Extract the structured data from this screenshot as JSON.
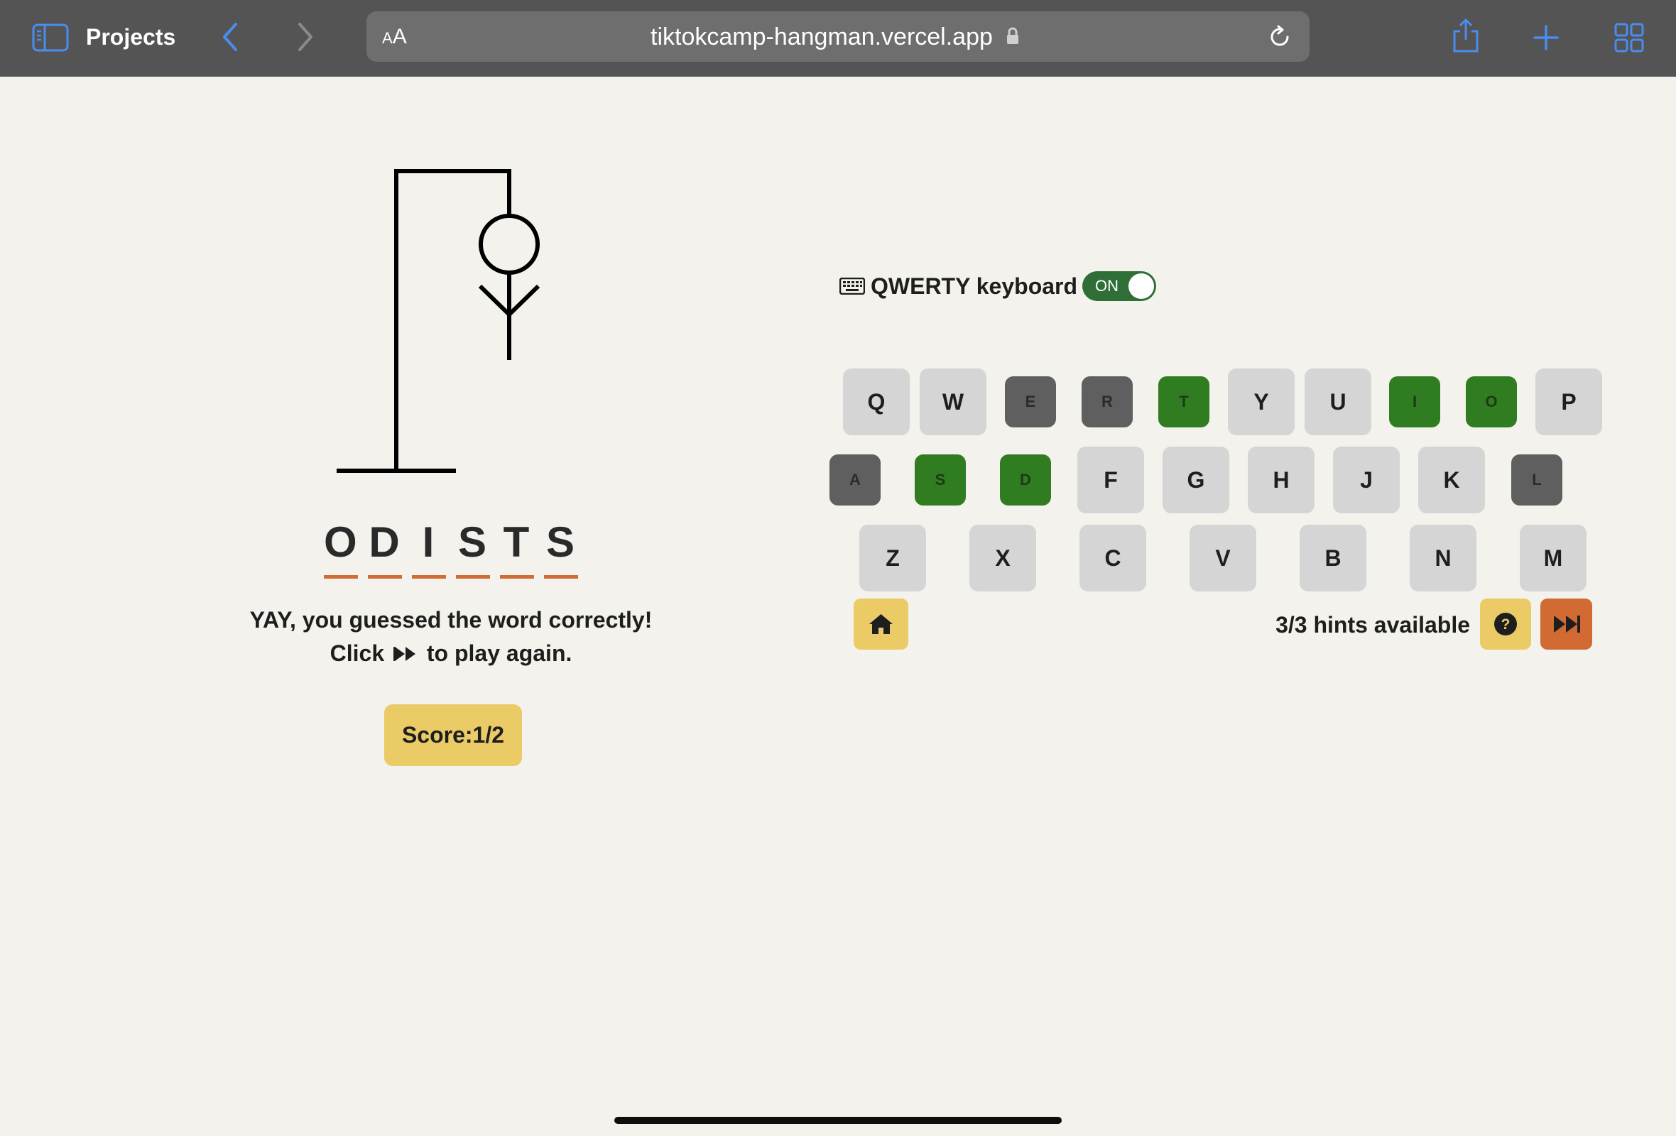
{
  "browser": {
    "sidebar_label": "Projects",
    "aa_label_small": "A",
    "aa_label_big": "A",
    "url": "tiktokcamp-hangman.vercel.app"
  },
  "game": {
    "word_letters": [
      "O",
      "D",
      "I",
      "S",
      "T",
      "S"
    ],
    "message_line1": "YAY, you guessed the word correctly!",
    "message_click": "Click",
    "message_rest": "to play again.",
    "score_label": "Score:1/2",
    "keyboard_label": "QWERTY keyboard",
    "toggle_label": "ON",
    "hints_label": "3/3 hints available"
  },
  "keyboard": {
    "rows": [
      [
        {
          "key": "Q",
          "state": "unused"
        },
        {
          "key": "W",
          "state": "unused"
        },
        {
          "key": "E",
          "state": "wrong"
        },
        {
          "key": "R",
          "state": "wrong"
        },
        {
          "key": "T",
          "state": "correct"
        },
        {
          "key": "Y",
          "state": "unused"
        },
        {
          "key": "U",
          "state": "unused"
        },
        {
          "key": "I",
          "state": "correct"
        },
        {
          "key": "O",
          "state": "correct"
        },
        {
          "key": "P",
          "state": "unused"
        }
      ],
      [
        {
          "key": "A",
          "state": "wrong"
        },
        {
          "key": "S",
          "state": "correct"
        },
        {
          "key": "D",
          "state": "correct"
        },
        {
          "key": "F",
          "state": "unused"
        },
        {
          "key": "G",
          "state": "unused"
        },
        {
          "key": "H",
          "state": "unused"
        },
        {
          "key": "J",
          "state": "unused"
        },
        {
          "key": "K",
          "state": "unused"
        },
        {
          "key": "L",
          "state": "wrong"
        }
      ],
      [
        {
          "key": "Z",
          "state": "unused"
        },
        {
          "key": "X",
          "state": "unused"
        },
        {
          "key": "C",
          "state": "unused"
        },
        {
          "key": "V",
          "state": "unused"
        },
        {
          "key": "B",
          "state": "unused"
        },
        {
          "key": "N",
          "state": "unused"
        },
        {
          "key": "M",
          "state": "unused"
        }
      ]
    ]
  },
  "colors": {
    "background": "#f3f2ec",
    "correct_key": "#307d21",
    "wrong_key": "#5f5f5f",
    "unused_key": "#d5d5d5",
    "accent_yellow": "#eacb66",
    "accent_orange": "#d16b33",
    "toggle_on": "#2f6f37"
  },
  "icons": {
    "sidebar": "sidebar-icon",
    "back": "chevron-left-icon",
    "forward": "chevron-right-icon",
    "lock": "lock-icon",
    "reload": "reload-icon",
    "share": "share-icon",
    "new_tab": "plus-icon",
    "tabs": "tabs-grid-icon",
    "keyboard": "keyboard-icon",
    "home": "home-icon",
    "hint": "question-icon",
    "next": "fast-forward-icon"
  }
}
